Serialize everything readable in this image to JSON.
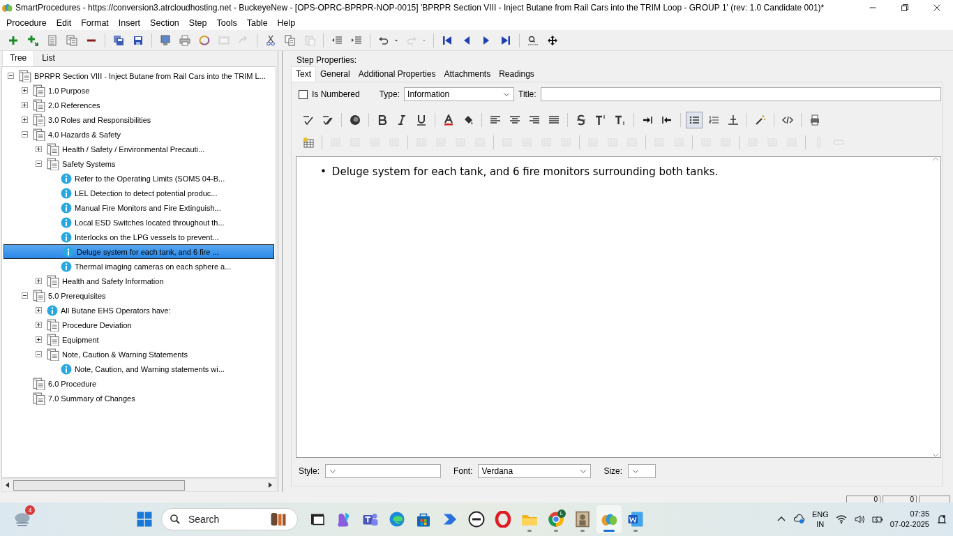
{
  "window": {
    "title": "SmartProcedures - https://conversion3.atrcloudhosting.net - BuckeyeNew - [OPS-OPRC-BPRPR-NOP-0015] 'BPRPR Section VIII - Inject Butane from Rail Cars into the TRIM Loop - GROUP 1' (rev: 1.0 Candidate 001)*"
  },
  "menu": [
    "Procedure",
    "Edit",
    "Format",
    "Insert",
    "Section",
    "Step",
    "Tools",
    "Table",
    "Help"
  ],
  "toolbar": [
    [
      {
        "kind": "add",
        "disabled": false
      },
      {
        "kind": "add-child",
        "disabled": false
      },
      {
        "kind": "list",
        "disabled": false
      },
      {
        "kind": "list-pages",
        "disabled": false
      },
      {
        "kind": "remove",
        "disabled": false
      }
    ],
    [
      {
        "kind": "save-all",
        "disabled": false
      },
      {
        "kind": "save",
        "disabled": false
      }
    ],
    [
      {
        "kind": "monitor",
        "disabled": false
      },
      {
        "kind": "printer",
        "disabled": false
      },
      {
        "kind": "ring",
        "disabled": false
      },
      {
        "kind": "panel",
        "disabled": true
      },
      {
        "kind": "forward",
        "disabled": true
      }
    ],
    [
      {
        "kind": "cut",
        "disabled": false
      },
      {
        "kind": "copy",
        "disabled": false
      },
      {
        "kind": "paste",
        "disabled": true
      }
    ],
    [
      {
        "kind": "outdent",
        "disabled": false
      },
      {
        "kind": "indent",
        "disabled": false
      }
    ],
    [
      {
        "kind": "undo",
        "disabled": false
      },
      {
        "kind": "redo",
        "disabled": true
      }
    ],
    [
      {
        "kind": "first",
        "disabled": false
      },
      {
        "kind": "prev",
        "disabled": false
      },
      {
        "kind": "next",
        "disabled": false
      },
      {
        "kind": "last",
        "disabled": false
      }
    ],
    [
      {
        "kind": "find",
        "disabled": false
      },
      {
        "kind": "move",
        "disabled": false
      }
    ]
  ],
  "left_tabs": [
    {
      "label": "Tree",
      "selected": true
    },
    {
      "label": "List",
      "selected": false
    }
  ],
  "tree": [
    {
      "label": "BPRPR Section VIII - Inject Butane from Rail Cars into the TRIM L...",
      "kind": "section",
      "expanded": true,
      "selected": false,
      "children": [
        {
          "label": "1.0 Purpose",
          "kind": "section",
          "expanded": false,
          "selected": false
        },
        {
          "label": "2.0 References",
          "kind": "section",
          "expanded": false,
          "selected": false
        },
        {
          "label": "3.0 Roles and Responsibilities",
          "kind": "section",
          "expanded": false,
          "selected": false
        },
        {
          "label": "4.0 Hazards & Safety",
          "kind": "section",
          "expanded": true,
          "selected": false,
          "children": [
            {
              "label": "Health / Safety / Environmental Precauti...",
              "kind": "section",
              "expanded": false,
              "selected": false
            },
            {
              "label": "Safety Systems",
              "kind": "section",
              "expanded": true,
              "selected": false,
              "children": [
                {
                  "label": "Refer to the Operating Limits (SOMS 04-B...",
                  "kind": "info",
                  "selected": false
                },
                {
                  "label": "LEL Detection to detect potential produc...",
                  "kind": "info",
                  "selected": false
                },
                {
                  "label": "Manual Fire Monitors and Fire Extinguish...",
                  "kind": "info",
                  "selected": false
                },
                {
                  "label": "Local ESD Switches located throughout th...",
                  "kind": "info",
                  "selected": false
                },
                {
                  "label": "Interlocks on the LPG vessels to prevent...",
                  "kind": "info",
                  "selected": false
                },
                {
                  "label": "Deluge system for each tank, and 6 fire ...",
                  "kind": "info",
                  "selected": true
                },
                {
                  "label": "Thermal imaging cameras on each sphere a...",
                  "kind": "info",
                  "selected": false
                }
              ]
            },
            {
              "label": "Health and Safety Information",
              "kind": "section",
              "expanded": false,
              "selected": false
            }
          ]
        },
        {
          "label": "5.0 Prerequisites",
          "kind": "section",
          "expanded": true,
          "selected": false,
          "children": [
            {
              "label": "All Butane EHS Operators have:",
              "kind": "info",
              "expanded": false,
              "selected": false
            },
            {
              "label": "Procedure Deviation",
              "kind": "section",
              "expanded": false,
              "selected": false
            },
            {
              "label": "Equipment",
              "kind": "section",
              "expanded": false,
              "selected": false
            },
            {
              "label": "Note, Caution & Warning Statements",
              "kind": "section",
              "expanded": true,
              "selected": false,
              "children": [
                {
                  "label": "Note, Caution, and Warning statements wi...",
                  "kind": "info",
                  "selected": false
                }
              ]
            }
          ]
        },
        {
          "label": "6.0 Procedure",
          "kind": "section",
          "selected": false
        },
        {
          "label": "7.0 Summary of Changes",
          "kind": "section",
          "selected": false
        }
      ]
    }
  ],
  "step_properties": {
    "heading": "Step Properties:",
    "tabs": [
      {
        "label": "Text",
        "selected": true
      },
      {
        "label": "General",
        "selected": false
      },
      {
        "label": "Additional Properties",
        "selected": false
      },
      {
        "label": "Attachments",
        "selected": false
      },
      {
        "label": "Readings",
        "selected": false
      }
    ],
    "is_numbered": {
      "label": "Is Numbered",
      "checked": false
    },
    "type": {
      "label": "Type:",
      "value": "Information"
    },
    "title": {
      "label": "Title:"
    },
    "format_rows": [
      [
        [
          {
            "kind": "spell",
            "disabled": false
          },
          {
            "kind": "spell2",
            "disabled": false
          }
        ],
        [
          {
            "kind": "ball",
            "disabled": false
          }
        ],
        [
          {
            "kind": "bold",
            "disabled": false
          },
          {
            "kind": "italic",
            "disabled": false
          },
          {
            "kind": "underline",
            "disabled": false
          }
        ],
        [
          {
            "kind": "font-color",
            "disabled": false
          },
          {
            "kind": "fill",
            "disabled": false
          }
        ],
        [
          {
            "kind": "align-left",
            "disabled": false
          },
          {
            "kind": "align-center",
            "disabled": false
          },
          {
            "kind": "align-right",
            "disabled": false
          },
          {
            "kind": "justify",
            "disabled": false
          }
        ],
        [
          {
            "kind": "strike",
            "disabled": false
          },
          {
            "kind": "superscript",
            "disabled": false
          },
          {
            "kind": "subscript",
            "disabled": false
          }
        ],
        [
          {
            "kind": "indent-in",
            "disabled": false
          },
          {
            "kind": "indent-out",
            "disabled": false
          }
        ],
        [
          {
            "kind": "bullets",
            "disabled": false,
            "selected": true
          },
          {
            "kind": "numbers",
            "disabled": false,
            "selected": false
          },
          {
            "kind": "rule",
            "disabled": false,
            "selected": false
          }
        ],
        [
          {
            "kind": "magic",
            "disabled": false
          }
        ],
        [
          {
            "kind": "code",
            "disabled": false
          }
        ],
        [
          {
            "kind": "print",
            "disabled": false
          }
        ]
      ],
      [
        [
          {
            "kind": "table-insert",
            "disabled": false
          }
        ],
        [
          {
            "kind": "table",
            "disabled": true
          },
          {
            "kind": "table",
            "disabled": true
          },
          {
            "kind": "table",
            "disabled": true
          },
          {
            "kind": "table",
            "disabled": true
          }
        ],
        [
          {
            "kind": "table",
            "disabled": true
          },
          {
            "kind": "table",
            "disabled": true
          },
          {
            "kind": "table",
            "disabled": true
          },
          {
            "kind": "table",
            "disabled": true
          }
        ],
        [
          {
            "kind": "table",
            "disabled": true
          },
          {
            "kind": "table",
            "disabled": true
          },
          {
            "kind": "table",
            "disabled": true
          },
          {
            "kind": "table",
            "disabled": true
          }
        ],
        [
          {
            "kind": "table",
            "disabled": true
          },
          {
            "kind": "table",
            "disabled": true
          },
          {
            "kind": "table",
            "disabled": true
          }
        ],
        [
          {
            "kind": "table",
            "disabled": true
          },
          {
            "kind": "table",
            "disabled": true
          }
        ],
        [
          {
            "kind": "table",
            "disabled": true
          },
          {
            "kind": "table",
            "disabled": true
          }
        ],
        [
          {
            "kind": "table",
            "disabled": true
          },
          {
            "kind": "table",
            "disabled": true
          },
          {
            "kind": "table",
            "disabled": true
          }
        ],
        [
          {
            "kind": "clip",
            "disabled": true
          },
          {
            "kind": "field",
            "disabled": true
          }
        ]
      ]
    ],
    "content": [
      {
        "bullet": "•",
        "text": "Deluge system for each tank, and 6 fire monitors surrounding both tanks."
      }
    ],
    "style": {
      "label": "Style:"
    },
    "font": {
      "label": "Font:",
      "value": "Verdana"
    },
    "size": {
      "label": "Size:"
    }
  },
  "status_bar": [
    "0",
    "0"
  ],
  "taskbar": {
    "weather_badge": "4",
    "search": {
      "placeholder": "Search"
    },
    "apps": [
      {
        "kind": "taskview",
        "running": false,
        "selected": false
      },
      {
        "kind": "copilot",
        "running": false,
        "selected": false
      },
      {
        "kind": "teams",
        "running": false,
        "selected": false
      },
      {
        "kind": "edge",
        "running": false,
        "selected": false
      },
      {
        "kind": "store",
        "running": false,
        "selected": false
      },
      {
        "kind": "automate",
        "running": false,
        "selected": false
      },
      {
        "kind": "dell",
        "running": false,
        "selected": false
      },
      {
        "kind": "opera",
        "running": false,
        "selected": false
      },
      {
        "kind": "folder",
        "running": true,
        "selected": false
      },
      {
        "kind": "chrome",
        "running": true,
        "selected": false,
        "badge": "L"
      },
      {
        "kind": "frame",
        "running": true,
        "selected": false
      },
      {
        "kind": "smart",
        "running": true,
        "selected": true
      },
      {
        "kind": "word",
        "running": true,
        "selected": false
      }
    ],
    "language": [
      "ENG",
      "IN"
    ],
    "time": "07:35",
    "date": "07-02-2025"
  }
}
